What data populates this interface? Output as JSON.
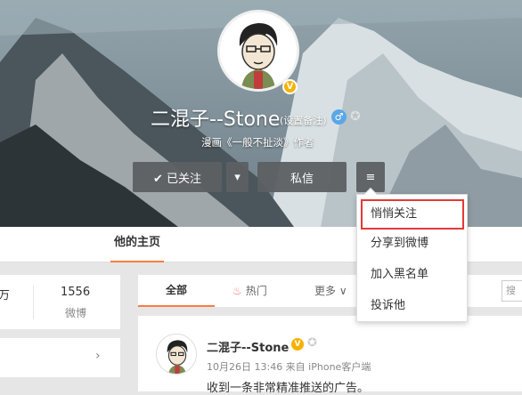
{
  "profile": {
    "name": "二混子--Stone",
    "remark_label": "(设置备注)",
    "bio": "漫画《一般不扯淡》作者",
    "verified_badge": "V",
    "gender_icon": "male-icon",
    "gender_symbol": "♂"
  },
  "actions": {
    "follow_label": "✔ 已关注",
    "dropdown_symbol": "▾",
    "message_label": "私信",
    "menu_symbol": "≡"
  },
  "menu": {
    "items": [
      {
        "label": "悄悄关注"
      },
      {
        "label": "分享到微博"
      },
      {
        "label": "加入黑名单"
      },
      {
        "label": "投诉他"
      }
    ]
  },
  "tabs": {
    "home_label": "他的主页"
  },
  "stats": {
    "partial": "万",
    "posts_count": "1556",
    "posts_label": "微博",
    "chevron": "›"
  },
  "filter": {
    "all_label": "全部",
    "hot_label": "热门",
    "more_label": "更多 ∨",
    "search_placeholder": "搜"
  },
  "post": {
    "author": "二混子--Stone",
    "badge": "V",
    "meta": "10月26日 13:46 来自 iPhone客户端",
    "text": "收到一条非常精准推送的广告。"
  },
  "colors": {
    "accent": "#fa7d3c",
    "highlight_box": "#e53935",
    "verified": "#f7b100"
  }
}
